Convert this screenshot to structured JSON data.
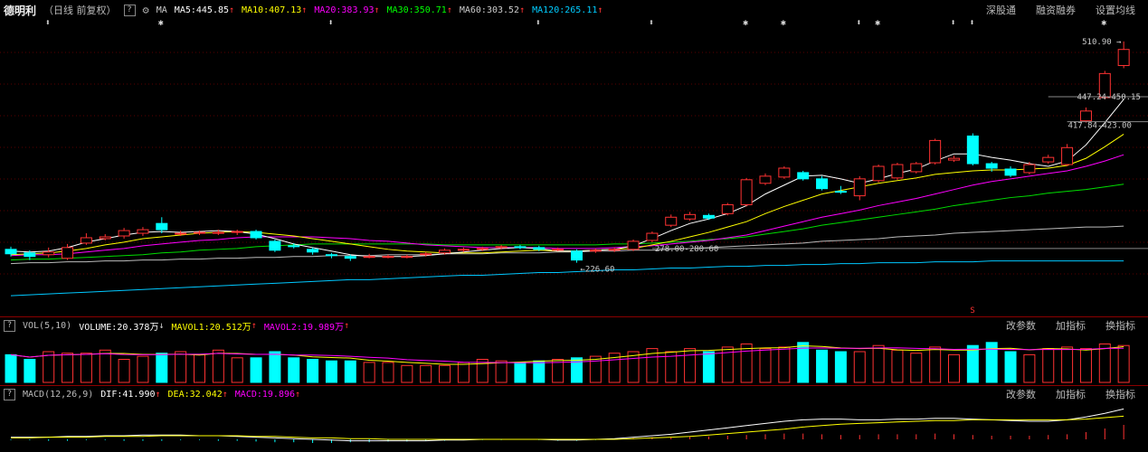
{
  "header": {
    "stock_name": "德明利",
    "period": "（日线 前复权）",
    "help_glyph": "?",
    "gear_icon": "gear-icon",
    "ma_label": "MA",
    "ma5": "MA5:445.85",
    "ma10": "MA10:407.13",
    "ma20": "MA20:383.93",
    "ma30": "MA30:350.71",
    "ma60": "MA60:303.52",
    "ma120": "MA120:265.11",
    "links": [
      "深股通",
      "融资融券",
      "设置均线"
    ],
    "colors": {
      "ma5": "#ffffff",
      "ma10": "#ffff00",
      "ma20": "#ff00ff",
      "ma30": "#00ff00",
      "ma60": "#cccccc",
      "ma120": "#00c8ff"
    }
  },
  "price_panel": {
    "high_label": "510.90",
    "low_label": "226.60",
    "range_label_1": "447.24-450.15",
    "range_label_2": "417.84-423.00",
    "range_label_3": "278.00-280.60",
    "signal_label": "S",
    "marker_glyphs": [
      "⬍",
      "✱",
      "⬍",
      "⬍",
      "⬍",
      "✱",
      "✱",
      "⬍",
      "✱",
      "⬍",
      "⬍",
      "✱"
    ]
  },
  "volume_panel": {
    "label": "VOL(5,10)",
    "volume": "VOLUME:20.378万",
    "mavol1": "MAVOL1:20.512万",
    "mavol2": "MAVOL2:19.989万",
    "links": [
      "改参数",
      "加指标",
      "换指标"
    ]
  },
  "macd_panel": {
    "label": "MACD(12,26,9)",
    "dif": "DIF:41.990",
    "dea": "DEA:32.042",
    "macd": "MACD:19.896",
    "links": [
      "改参数",
      "加指标",
      "换指标"
    ]
  },
  "chart_data": {
    "type": "candlestick",
    "ylim": [
      215,
      525
    ],
    "candles": [
      {
        "o": 278,
        "c": 273,
        "h": 281,
        "l": 270
      },
      {
        "o": 274,
        "c": 270,
        "h": 277,
        "l": 266
      },
      {
        "o": 272,
        "c": 275,
        "h": 280,
        "l": 269
      },
      {
        "o": 268,
        "c": 280,
        "h": 284,
        "l": 266
      },
      {
        "o": 285,
        "c": 291,
        "h": 296,
        "l": 283
      },
      {
        "o": 290,
        "c": 292,
        "h": 295,
        "l": 288
      },
      {
        "o": 293,
        "c": 299,
        "h": 302,
        "l": 290
      },
      {
        "o": 296,
        "c": 300,
        "h": 303,
        "l": 293
      },
      {
        "o": 307,
        "c": 300,
        "h": 314,
        "l": 296
      },
      {
        "o": 296,
        "c": 296,
        "h": 299,
        "l": 293
      },
      {
        "o": 296,
        "c": 297,
        "h": 299,
        "l": 294
      },
      {
        "o": 297,
        "c": 297,
        "h": 300,
        "l": 294
      },
      {
        "o": 297,
        "c": 298,
        "h": 300,
        "l": 294
      },
      {
        "o": 298,
        "c": 291,
        "h": 300,
        "l": 289
      },
      {
        "o": 287,
        "c": 277,
        "h": 289,
        "l": 275
      },
      {
        "o": 282,
        "c": 281,
        "h": 285,
        "l": 279
      },
      {
        "o": 278,
        "c": 275,
        "h": 280,
        "l": 272
      },
      {
        "o": 272,
        "c": 271,
        "h": 274,
        "l": 268
      },
      {
        "o": 270,
        "c": 268,
        "h": 272,
        "l": 265
      },
      {
        "o": 270,
        "c": 270,
        "h": 273,
        "l": 268
      },
      {
        "o": 270,
        "c": 270,
        "h": 272,
        "l": 268
      },
      {
        "o": 270,
        "c": 270,
        "h": 272,
        "l": 268
      },
      {
        "o": 272,
        "c": 273,
        "h": 275,
        "l": 270
      },
      {
        "o": 274,
        "c": 277,
        "h": 279,
        "l": 272
      },
      {
        "o": 277,
        "c": 278,
        "h": 280,
        "l": 275
      },
      {
        "o": 278,
        "c": 279,
        "h": 281,
        "l": 276
      },
      {
        "o": 280,
        "c": 281,
        "h": 283,
        "l": 278
      },
      {
        "o": 281,
        "c": 280,
        "h": 283,
        "l": 278
      },
      {
        "o": 280,
        "c": 278,
        "h": 282,
        "l": 276
      },
      {
        "o": 278,
        "c": 278,
        "h": 280,
        "l": 276
      },
      {
        "o": 276,
        "c": 266,
        "h": 278,
        "l": 263
      },
      {
        "o": 276,
        "c": 277,
        "h": 279,
        "l": 274
      },
      {
        "o": 277,
        "c": 278,
        "h": 280,
        "l": 275
      },
      {
        "o": 278,
        "c": 287,
        "h": 289,
        "l": 276
      },
      {
        "o": 288,
        "c": 296,
        "h": 298,
        "l": 286
      },
      {
        "o": 305,
        "c": 314,
        "h": 317,
        "l": 303
      },
      {
        "o": 312,
        "c": 317,
        "h": 320,
        "l": 310
      },
      {
        "o": 316,
        "c": 313,
        "h": 318,
        "l": 311
      },
      {
        "o": 318,
        "c": 328,
        "h": 330,
        "l": 316
      },
      {
        "o": 328,
        "c": 356,
        "h": 358,
        "l": 326
      },
      {
        "o": 352,
        "c": 360,
        "h": 363,
        "l": 350
      },
      {
        "o": 359,
        "c": 369,
        "h": 371,
        "l": 357
      },
      {
        "o": 364,
        "c": 357,
        "h": 366,
        "l": 355
      },
      {
        "o": 357,
        "c": 346,
        "h": 360,
        "l": 344
      },
      {
        "o": 343,
        "c": 342,
        "h": 349,
        "l": 340
      },
      {
        "o": 338,
        "c": 357,
        "h": 360,
        "l": 333
      },
      {
        "o": 355,
        "c": 371,
        "h": 373,
        "l": 353
      },
      {
        "o": 358,
        "c": 373,
        "h": 375,
        "l": 356
      },
      {
        "o": 365,
        "c": 374,
        "h": 376,
        "l": 363
      },
      {
        "o": 375,
        "c": 400,
        "h": 402,
        "l": 373
      },
      {
        "o": 378,
        "c": 380,
        "h": 383,
        "l": 376
      },
      {
        "o": 405,
        "c": 374,
        "h": 408,
        "l": 372
      },
      {
        "o": 374,
        "c": 369,
        "h": 376,
        "l": 365
      },
      {
        "o": 368,
        "c": 361,
        "h": 371,
        "l": 359
      },
      {
        "o": 364,
        "c": 373,
        "h": 376,
        "l": 362
      },
      {
        "o": 376,
        "c": 381,
        "h": 384,
        "l": 374
      },
      {
        "o": 373,
        "c": 392,
        "h": 396,
        "l": 371
      },
      {
        "o": 422,
        "c": 433,
        "h": 437,
        "l": 420
      },
      {
        "o": 448,
        "c": 475,
        "h": 478,
        "l": 446
      },
      {
        "o": 484,
        "c": 502,
        "h": 511,
        "l": 481
      }
    ],
    "ma5": [
      276,
      275,
      276,
      280,
      286,
      290,
      294,
      297,
      298,
      297,
      298,
      299,
      298,
      295,
      290,
      284,
      280,
      276,
      272,
      270,
      270,
      270,
      271,
      273,
      275,
      277,
      279,
      280,
      279,
      276,
      276,
      277,
      278,
      282,
      290,
      299,
      307,
      312,
      318,
      327,
      340,
      350,
      360,
      361,
      357,
      352,
      357,
      363,
      368,
      377,
      385,
      385,
      381,
      378,
      374,
      371,
      377,
      395,
      420,
      446
    ],
    "ma10": [
      272,
      273,
      274,
      276,
      279,
      283,
      286,
      290,
      292,
      294,
      296,
      297,
      298,
      297,
      295,
      293,
      290,
      287,
      284,
      281,
      278,
      276,
      275,
      274,
      274,
      274,
      275,
      276,
      277,
      276,
      276,
      277,
      278,
      279,
      283,
      287,
      292,
      297,
      303,
      309,
      318,
      326,
      333,
      340,
      344,
      348,
      352,
      355,
      358,
      362,
      364,
      366,
      367,
      367,
      368,
      369,
      372,
      380,
      393,
      407
    ],
    "ma20": [
      271,
      272,
      272,
      273,
      275,
      277,
      279,
      282,
      284,
      286,
      288,
      289,
      291,
      292,
      292,
      292,
      292,
      291,
      290,
      288,
      287,
      285,
      283,
      282,
      281,
      280,
      280,
      280,
      280,
      279,
      279,
      279,
      280,
      281,
      282,
      284,
      286,
      288,
      291,
      294,
      299,
      304,
      309,
      314,
      318,
      322,
      327,
      331,
      335,
      340,
      345,
      350,
      354,
      357,
      360,
      363,
      366,
      371,
      377,
      384
    ],
    "ma30": [
      266,
      267,
      267,
      268,
      269,
      270,
      271,
      272,
      274,
      275,
      277,
      278,
      279,
      281,
      282,
      283,
      284,
      284,
      284,
      284,
      284,
      284,
      284,
      283,
      283,
      283,
      283,
      283,
      283,
      283,
      283,
      283,
      284,
      284,
      285,
      286,
      287,
      289,
      290,
      292,
      295,
      298,
      301,
      305,
      308,
      311,
      314,
      317,
      320,
      323,
      327,
      330,
      333,
      336,
      338,
      341,
      343,
      345,
      348,
      351
    ],
    "ma60": [
      262,
      263,
      263,
      264,
      264,
      265,
      265,
      266,
      266,
      267,
      267,
      268,
      268,
      269,
      269,
      270,
      270,
      271,
      271,
      271,
      272,
      272,
      272,
      273,
      273,
      273,
      274,
      274,
      274,
      275,
      275,
      276,
      276,
      277,
      277,
      278,
      279,
      280,
      281,
      282,
      283,
      284,
      285,
      287,
      288,
      289,
      290,
      292,
      293,
      294,
      296,
      297,
      298,
      299,
      300,
      301,
      302,
      303,
      303,
      304
    ],
    "ma120": [
      226,
      227,
      228,
      229,
      230,
      231,
      232,
      233,
      234,
      235,
      236,
      237,
      238,
      239,
      240,
      241,
      242,
      243,
      244,
      244,
      245,
      246,
      247,
      248,
      249,
      249,
      250,
      251,
      252,
      252,
      253,
      254,
      255,
      255,
      256,
      257,
      257,
      258,
      259,
      259,
      260,
      260,
      261,
      261,
      262,
      262,
      263,
      263,
      263,
      264,
      264,
      264,
      265,
      265,
      265,
      265,
      265,
      265,
      265,
      265
    ],
    "volume": [
      18,
      15,
      20,
      19,
      19,
      21,
      15,
      17,
      19,
      20,
      18,
      21,
      16,
      16,
      20,
      16,
      15,
      14,
      14,
      13,
      13,
      11,
      11,
      11,
      13,
      15,
      14,
      13,
      14,
      15,
      16,
      17,
      19,
      20,
      22,
      20,
      22,
      20,
      23,
      25,
      22,
      23,
      26,
      21,
      20,
      20,
      24,
      21,
      19,
      23,
      18,
      24,
      26,
      20,
      18,
      22,
      23,
      22,
      25,
      24
    ],
    "macd_hist": [
      -1,
      -1,
      -2,
      -2,
      -1,
      -1,
      -2,
      -2,
      -2,
      -1,
      -1,
      -2,
      -2,
      -3,
      -4,
      -4,
      -5,
      -5,
      -4,
      -4,
      -3,
      -3,
      -2,
      -2,
      -1,
      -1,
      -1,
      0,
      -1,
      -2,
      -2,
      -1,
      1,
      2,
      3,
      3,
      4,
      4,
      5,
      6,
      7,
      8,
      8,
      7,
      6,
      6,
      7,
      7,
      7,
      8,
      7,
      6,
      5,
      5,
      5,
      6,
      7,
      10,
      15,
      20
    ],
    "dif": [
      3,
      3,
      3,
      4,
      4,
      5,
      5,
      6,
      6,
      6,
      5,
      5,
      4,
      3,
      2,
      1,
      0,
      -1,
      -2,
      -2,
      -2,
      -2,
      -2,
      -1,
      -1,
      0,
      0,
      0,
      0,
      -1,
      -1,
      0,
      1,
      3,
      5,
      7,
      10,
      13,
      16,
      19,
      22,
      25,
      27,
      28,
      28,
      27,
      27,
      28,
      28,
      29,
      29,
      28,
      27,
      26,
      25,
      25,
      27,
      31,
      36,
      42
    ],
    "dea": [
      2,
      2,
      3,
      3,
      3,
      4,
      4,
      4,
      5,
      5,
      5,
      5,
      5,
      4,
      4,
      3,
      2,
      2,
      1,
      1,
      0,
      0,
      0,
      0,
      0,
      0,
      0,
      0,
      0,
      0,
      0,
      0,
      0,
      1,
      2,
      3,
      4,
      6,
      8,
      10,
      12,
      14,
      17,
      19,
      21,
      22,
      23,
      24,
      25,
      26,
      26,
      27,
      27,
      27,
      27,
      27,
      27,
      28,
      30,
      32
    ]
  }
}
